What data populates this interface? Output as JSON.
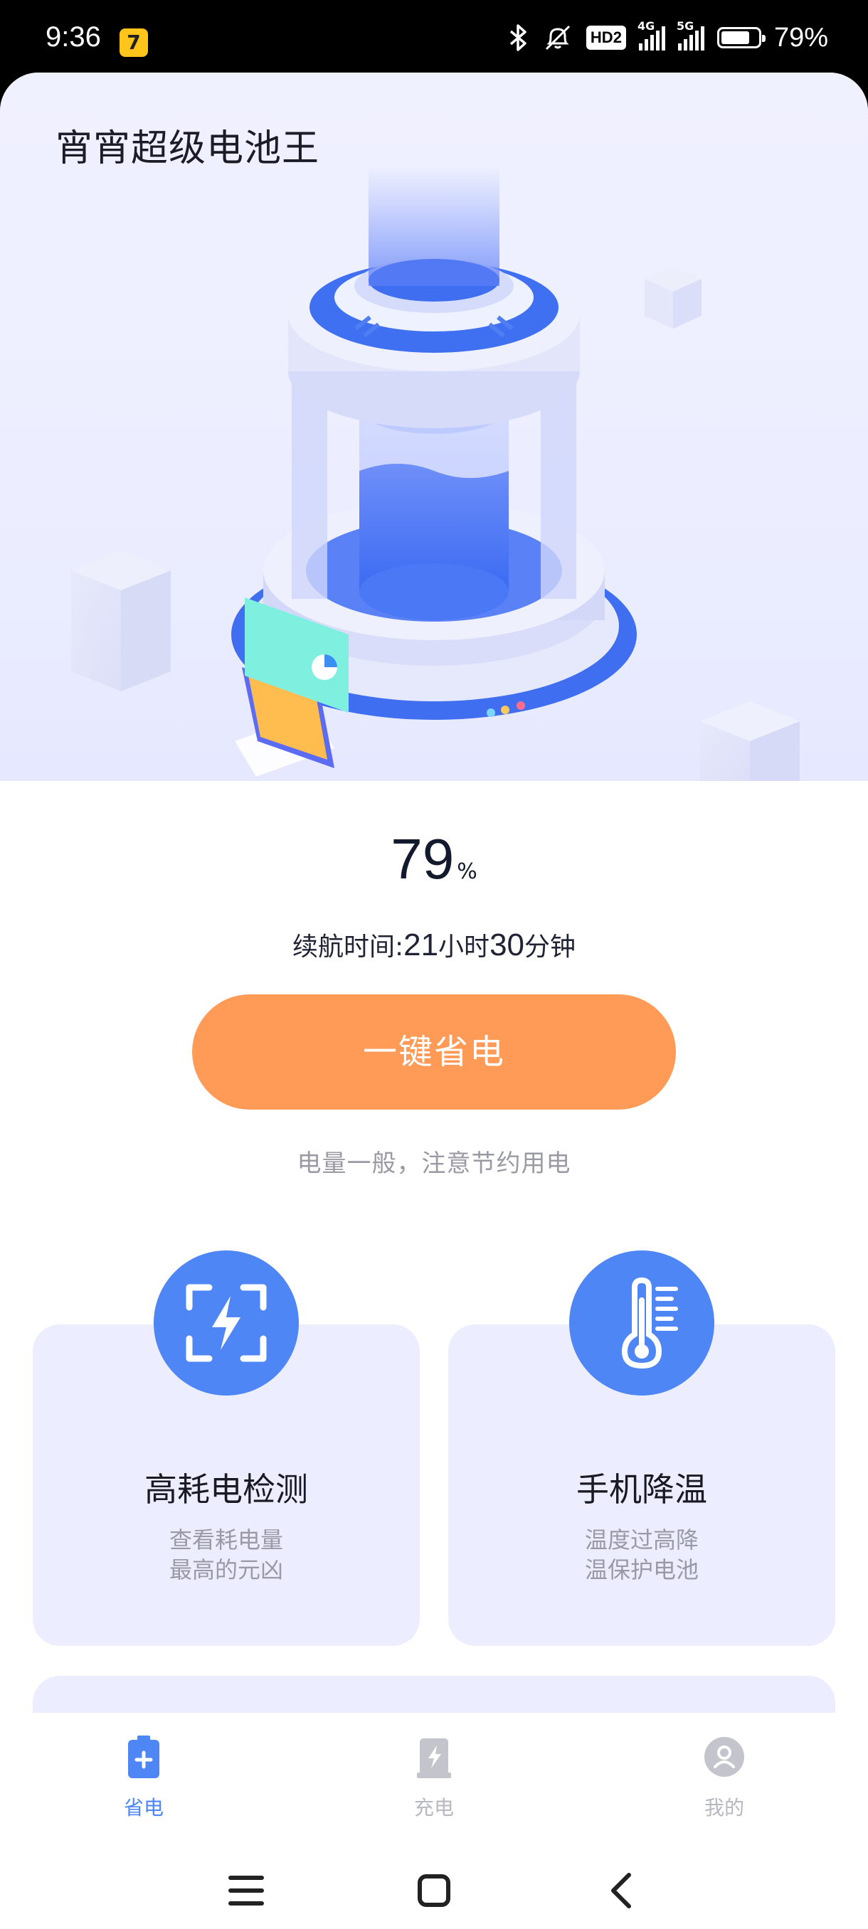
{
  "status_bar": {
    "time": "9:36",
    "app_badge": "7",
    "hd_label": "HD2",
    "net1": "4G",
    "net2": "5G",
    "battery_text": "79%",
    "battery_level": 0.79,
    "icons": [
      "bluetooth-icon",
      "mute-icon",
      "signal-icon",
      "battery-icon"
    ]
  },
  "app": {
    "title": "宵宵超级电池王"
  },
  "battery": {
    "percent": "79",
    "percent_sign": "%",
    "endurance_prefix": "续航时间:",
    "hours": "21",
    "hours_unit": "小时",
    "minutes": "30",
    "minutes_unit": "分钟",
    "save_button": "一键省电",
    "hint": "电量一般，注意节约用电"
  },
  "cards": [
    {
      "title": "高耗电检测",
      "desc": "查看耗电量最高的元凶",
      "icon": "scan-bolt-icon"
    },
    {
      "title": "手机降温",
      "desc": "温度过高降温保护电池",
      "icon": "thermometer-icon"
    }
  ],
  "tabs": [
    {
      "label": "省电",
      "icon": "battery-plus-icon",
      "active": true
    },
    {
      "label": "充电",
      "icon": "charge-icon",
      "active": false
    },
    {
      "label": "我的",
      "icon": "profile-icon",
      "active": false
    }
  ],
  "colors": {
    "accent_orange": "#ff9a57",
    "primary_blue": "#4e86f6",
    "card_bg": "#eceeff",
    "tab_inactive": "#c4c4cc"
  }
}
